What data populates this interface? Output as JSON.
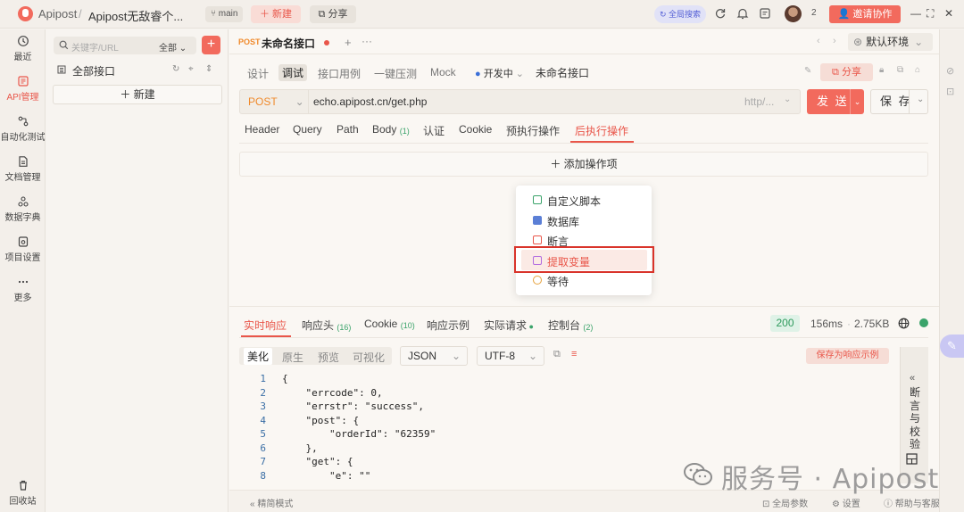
{
  "titlebar": {
    "app_name": "Apipost",
    "separator": "/",
    "project": "Apipost无敌睿个...",
    "branch": "main",
    "new_label": "新建",
    "share_label": "分享",
    "global_search": "全局搜索",
    "member_count": "2",
    "invite_label": "邀请协作"
  },
  "rail": {
    "items": [
      {
        "label": "最近",
        "icon": "clock-icon"
      },
      {
        "label": "API管理",
        "icon": "api-icon"
      },
      {
        "label": "自动化测试",
        "icon": "flow-icon"
      },
      {
        "label": "文档管理",
        "icon": "doc-icon"
      },
      {
        "label": "数据字典",
        "icon": "dict-icon"
      },
      {
        "label": "项目设置",
        "icon": "settings-icon"
      },
      {
        "label": "更多",
        "icon": "more-icon"
      }
    ],
    "trash_label": "回收站",
    "active_color": "#e9564a"
  },
  "sidebar": {
    "search_placeholder": "关键字/URL",
    "filter_label": "全部",
    "all_apis": "全部接口",
    "new_label": "新建"
  },
  "tab": {
    "method": "POST",
    "name": "未命名接口",
    "environment": "默认环境"
  },
  "subtabs": {
    "items": [
      "设计",
      "调试",
      "接口用例",
      "一键压测",
      "Mock"
    ],
    "active": "调试",
    "status": "开发中",
    "api_name": "未命名接口",
    "share_label": "分享"
  },
  "request": {
    "method": "POST",
    "url": "echo.apipost.cn/get.php",
    "url_hint": "http/...",
    "send_label": "发 送",
    "save_label": "保 存"
  },
  "param_tabs": {
    "items": [
      {
        "label": "Header",
        "count": ""
      },
      {
        "label": "Query",
        "count": ""
      },
      {
        "label": "Path",
        "count": ""
      },
      {
        "label": "Body",
        "count": "(1)"
      },
      {
        "label": "认证",
        "count": ""
      },
      {
        "label": "Cookie",
        "count": ""
      },
      {
        "label": "预执行操作",
        "count": ""
      },
      {
        "label": "后执行操作",
        "count": ""
      }
    ],
    "active": "后执行操作",
    "add_op_label": "添加操作项"
  },
  "op_menu": {
    "items": [
      {
        "label": "自定义脚本",
        "color": "#3aa36a"
      },
      {
        "label": "数据库",
        "color": "#5b7fd6"
      },
      {
        "label": "断言",
        "color": "#e9564a"
      },
      {
        "label": "提取变量",
        "color": "#b26be0"
      },
      {
        "label": "等待",
        "color": "#e6a23c"
      }
    ],
    "highlighted": "提取变量"
  },
  "response": {
    "tabs": [
      {
        "label": "实时响应",
        "count": ""
      },
      {
        "label": "响应头",
        "count": "(16)"
      },
      {
        "label": "Cookie",
        "count": "(10)"
      },
      {
        "label": "响应示例",
        "count": ""
      },
      {
        "label": "实际请求",
        "count": ""
      },
      {
        "label": "控制台",
        "count": "(2)"
      }
    ],
    "status": "200",
    "time": "156ms",
    "size": "2.75KB",
    "views": [
      "美化",
      "原生",
      "预览",
      "可视化"
    ],
    "active_view": "美化",
    "format": "JSON",
    "encoding": "UTF-8",
    "save_example": "保存为响应示例",
    "assert_panel_label": "断言与校验",
    "code_lines": [
      {
        "n": "1",
        "text": "{"
      },
      {
        "n": "2",
        "text": "    \"errcode\": 0,"
      },
      {
        "n": "3",
        "text": "    \"errstr\": \"success\","
      },
      {
        "n": "4",
        "text": "    \"post\": {"
      },
      {
        "n": "5",
        "text": "        \"orderId\": \"62359\""
      },
      {
        "n": "6",
        "text": "    },"
      },
      {
        "n": "7",
        "text": "    \"get\": {"
      },
      {
        "n": "8",
        "text": "        \"e\": \"\""
      }
    ]
  },
  "statusbar": {
    "simple_mode": "精简模式",
    "global_params": "全局参数",
    "settings": "设置",
    "help": "帮助与客服"
  },
  "watermark": "服务号 · Apipost"
}
